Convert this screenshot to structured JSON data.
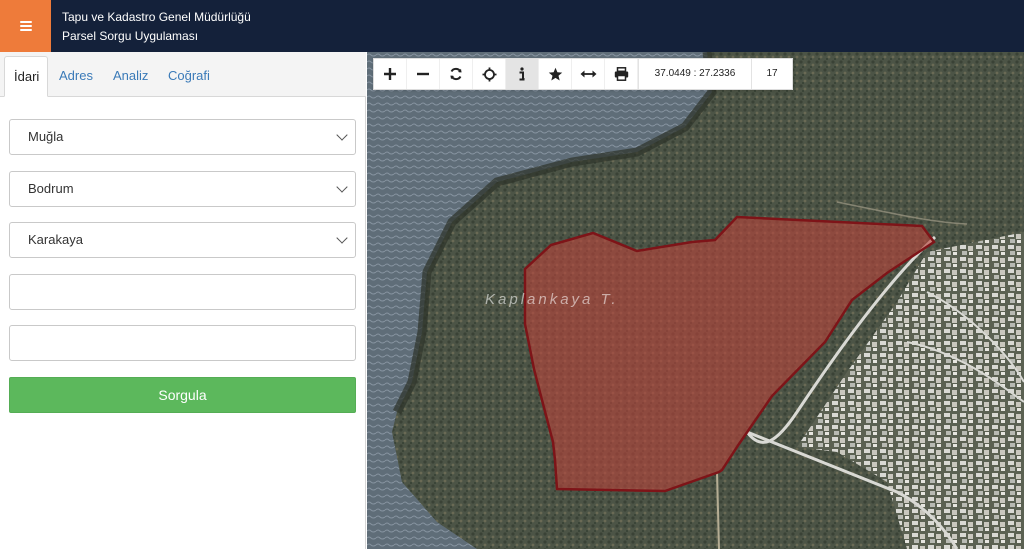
{
  "header": {
    "title": "Tapu ve Kadastro Genel Müdürlüğü",
    "subtitle": "Parsel Sorgu Uygulaması",
    "menu_icon": "hamburger-icon",
    "colors": {
      "bar": "#14213a",
      "menu_button": "#ee7b3a"
    }
  },
  "tabs": [
    {
      "label": "İdari",
      "active": true
    },
    {
      "label": "Adres",
      "active": false
    },
    {
      "label": "Analiz",
      "active": false
    },
    {
      "label": "Coğrafi",
      "active": false
    }
  ],
  "form": {
    "province": "Muğla",
    "district": "Bodrum",
    "neighborhood": "Karakaya",
    "block_value": "",
    "parcel_value": "",
    "submit_label": "Sorgula",
    "submit_color": "#5cb85c"
  },
  "map": {
    "toolbar": {
      "icons": [
        "zoom-in-icon",
        "zoom-out-icon",
        "refresh-icon",
        "locate-icon",
        "info-icon",
        "favorite-star-icon",
        "measure-icon",
        "print-icon"
      ],
      "active_tool": "info-icon",
      "coordinates": "37.0449 : 27.2336",
      "zoom": "17"
    },
    "place_label": "Kaplankaya T.",
    "parcel_fill": "#b7433b",
    "parcel_stroke": "#7e1418"
  }
}
